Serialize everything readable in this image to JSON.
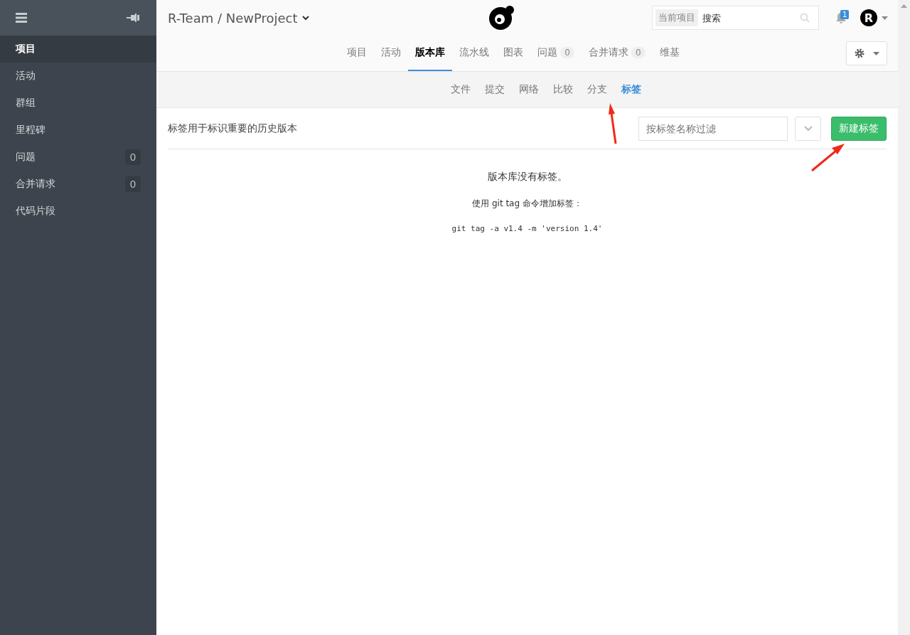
{
  "sidebar": {
    "items": [
      {
        "label": "项目",
        "selected": true
      },
      {
        "label": "活动",
        "selected": false
      },
      {
        "label": "群组",
        "selected": false
      },
      {
        "label": "里程碑",
        "selected": false
      },
      {
        "label": "问题",
        "selected": false,
        "count": "0"
      },
      {
        "label": "合并请求",
        "selected": false,
        "count": "0"
      },
      {
        "label": "代码片段",
        "selected": false
      }
    ]
  },
  "header": {
    "project_title": "R-Team / NewProject",
    "search": {
      "scope": "当前项目",
      "placeholder": "搜索"
    },
    "notification_count": "1",
    "avatar_letter": "R"
  },
  "tabs": [
    {
      "label": "项目",
      "selected": false
    },
    {
      "label": "活动",
      "selected": false
    },
    {
      "label": "版本库",
      "selected": true
    },
    {
      "label": "流水线",
      "selected": false
    },
    {
      "label": "图表",
      "selected": false
    },
    {
      "label": "问题",
      "selected": false,
      "count": "0"
    },
    {
      "label": "合并请求",
      "selected": false,
      "count": "0"
    },
    {
      "label": "维基",
      "selected": false
    }
  ],
  "subtabs": [
    {
      "label": "文件",
      "selected": false
    },
    {
      "label": "提交",
      "selected": false
    },
    {
      "label": "网络",
      "selected": false
    },
    {
      "label": "比较",
      "selected": false
    },
    {
      "label": "分支",
      "selected": false
    },
    {
      "label": "标签",
      "selected": true
    }
  ],
  "toolbar": {
    "description": "标签用于标识重要的历史版本",
    "filter": {
      "placeholder": "按标签名称过滤"
    },
    "new_button": "新建标签"
  },
  "empty_state": {
    "title": "版本库没有标签。",
    "hint": "使用 git tag 命令增加标签：",
    "command": "git tag -a v1.4 -m 'version 1.4'"
  }
}
